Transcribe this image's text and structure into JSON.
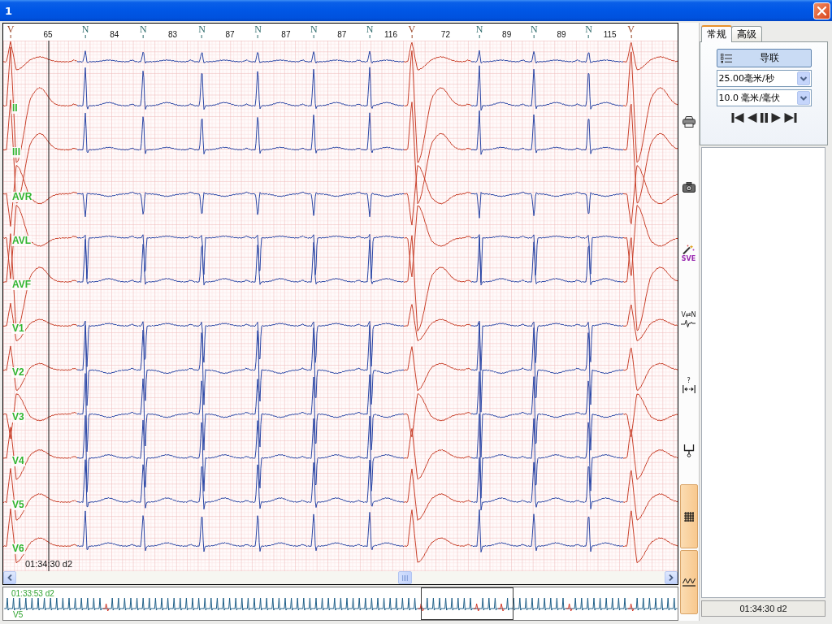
{
  "window": {
    "title": "1"
  },
  "ecg": {
    "beats": [
      {
        "label": "V",
        "kind": "ventricular",
        "rate": "65"
      },
      {
        "label": "N",
        "kind": "normal",
        "rate": "84"
      },
      {
        "label": "N",
        "kind": "normal",
        "rate": "83"
      },
      {
        "label": "N",
        "kind": "normal",
        "rate": "87"
      },
      {
        "label": "N",
        "kind": "normal",
        "rate": "87"
      },
      {
        "label": "N",
        "kind": "normal",
        "rate": "87"
      },
      {
        "label": "N",
        "kind": "normal",
        "rate": "116"
      },
      {
        "label": "V",
        "kind": "ventricular",
        "rate": "72"
      },
      {
        "label": "N",
        "kind": "normal",
        "rate": "89"
      },
      {
        "label": "N",
        "kind": "normal",
        "rate": "89"
      },
      {
        "label": "N",
        "kind": "normal",
        "rate": "115"
      },
      {
        "label": "V",
        "kind": "ventricular"
      }
    ],
    "lead_labels": [
      "II",
      "III",
      "AVR",
      "AVL",
      "AVF",
      "V1",
      "V2",
      "V3",
      "V4",
      "V5",
      "V6"
    ],
    "cursor_time": "01:34:30 d2"
  },
  "overview": {
    "time": "01:33:53 d2",
    "lead": "V5"
  },
  "toolbar": [
    {
      "kind": "print",
      "on": false
    },
    {
      "kind": "camera",
      "on": false
    },
    {
      "kind": "sve",
      "label": "SVE",
      "on": false
    },
    {
      "kind": "swap",
      "label": "V⇄N",
      "on": false
    },
    {
      "kind": "measure",
      "label": "?",
      "on": false
    },
    {
      "kind": "marker",
      "on": false
    },
    {
      "kind": "grid",
      "on": true
    },
    {
      "kind": "wave",
      "on": true
    }
  ],
  "side_panel": {
    "tabs": [
      {
        "label": "常规",
        "selected": true
      },
      {
        "label": "高级",
        "selected": false
      }
    ],
    "leads_button": "导联",
    "speed": "25.00毫米/秒",
    "gain": "10.0 毫米/毫伏",
    "status": "01:34:30 d2"
  }
}
